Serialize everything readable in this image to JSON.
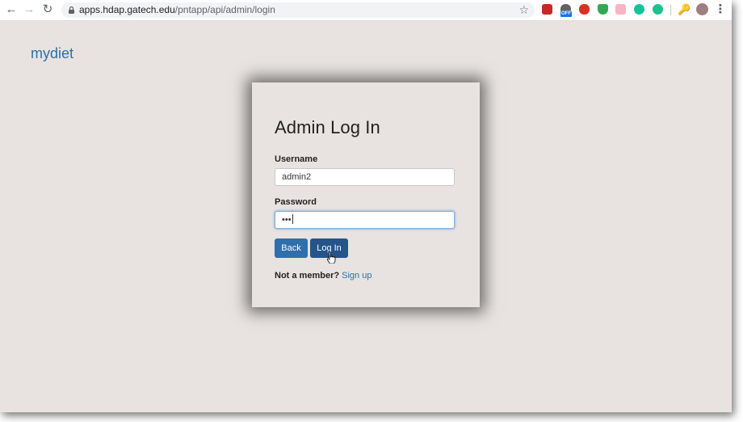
{
  "browser": {
    "url_host": "apps.hdap.gatech.edu",
    "url_path": "/pntapp/api/admin/login",
    "extensions": [
      "video-ext-icon",
      "offline-ext-icon",
      "mascot-ext-icon",
      "shield-ext-icon",
      "ribbon-ext-icon",
      "grammarly-ext-icon",
      "refresh-ext-icon"
    ],
    "off_badge": "OFF"
  },
  "page": {
    "brand": "mydiet"
  },
  "login_card": {
    "title": "Admin Log In",
    "username_label": "Username",
    "username_value": "admin2",
    "password_label": "Password",
    "password_value": "•••",
    "back_button": "Back",
    "login_button": "Log In",
    "footer_prompt": "Not a member?",
    "footer_link": "Sign up"
  },
  "colors": {
    "accent": "#2d6fa8",
    "page_bg": "#e8e3e0",
    "back_button": "#2f6fac",
    "login_button": "#24548a"
  }
}
